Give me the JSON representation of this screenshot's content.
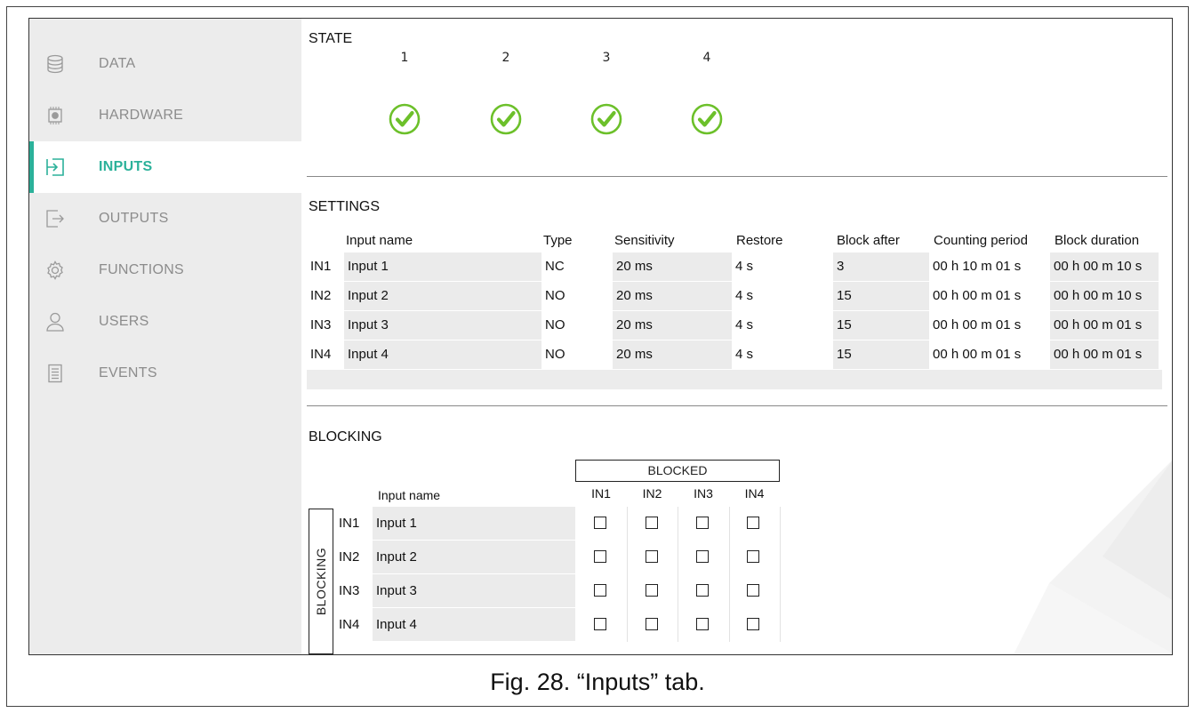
{
  "sidebar": {
    "items": [
      {
        "label": "DATA",
        "icon": "database-icon",
        "active": false
      },
      {
        "label": "HARDWARE",
        "icon": "chip-icon",
        "active": false
      },
      {
        "label": "INPUTS",
        "icon": "input-icon",
        "active": true
      },
      {
        "label": "OUTPUTS",
        "icon": "output-icon",
        "active": false
      },
      {
        "label": "FUNCTIONS",
        "icon": "gear-icon",
        "active": false
      },
      {
        "label": "USERS",
        "icon": "user-icon",
        "active": false
      },
      {
        "label": "EVENTS",
        "icon": "document-icon",
        "active": false
      }
    ]
  },
  "state": {
    "title": "STATE",
    "inputs": [
      {
        "num": "1",
        "status": "ok"
      },
      {
        "num": "2",
        "status": "ok"
      },
      {
        "num": "3",
        "status": "ok"
      },
      {
        "num": "4",
        "status": "ok"
      }
    ]
  },
  "settings": {
    "title": "SETTINGS",
    "columns": [
      "Input name",
      "Type",
      "Sensitivity",
      "Restore",
      "Block after",
      "Counting period",
      "Block duration"
    ],
    "rows": [
      {
        "id": "IN1",
        "name": "Input 1",
        "type": "NC",
        "sensitivity": "20 ms",
        "restore": "4 s",
        "block_after": "3",
        "counting_period": "00 h 10 m 01 s",
        "block_duration": "00 h 00 m 10 s"
      },
      {
        "id": "IN2",
        "name": "Input 2",
        "type": "NO",
        "sensitivity": "20 ms",
        "restore": "4 s",
        "block_after": "15",
        "counting_period": "00 h 00 m 01 s",
        "block_duration": "00 h 00 m 10 s"
      },
      {
        "id": "IN3",
        "name": "Input 3",
        "type": "NO",
        "sensitivity": "20 ms",
        "restore": "4 s",
        "block_after": "15",
        "counting_period": "00 h 00 m 01 s",
        "block_duration": "00 h 00 m 01 s"
      },
      {
        "id": "IN4",
        "name": "Input 4",
        "type": "NO",
        "sensitivity": "20 ms",
        "restore": "4 s",
        "block_after": "15",
        "counting_period": "00 h 00 m 01 s",
        "block_duration": "00 h 00 m 01 s"
      }
    ]
  },
  "blocking": {
    "title": "BLOCKING",
    "blocked_header": "BLOCKED",
    "side_label": "BLOCKING",
    "name_header": "Input name",
    "columns": [
      "IN1",
      "IN2",
      "IN3",
      "IN4"
    ],
    "rows": [
      {
        "id": "IN1",
        "name": "Input 1",
        "checked": [
          false,
          false,
          false,
          false
        ]
      },
      {
        "id": "IN2",
        "name": "Input 2",
        "checked": [
          false,
          false,
          false,
          false
        ]
      },
      {
        "id": "IN3",
        "name": "Input 3",
        "checked": [
          false,
          false,
          false,
          false
        ]
      },
      {
        "id": "IN4",
        "name": "Input 4",
        "checked": [
          false,
          false,
          false,
          false
        ]
      }
    ]
  },
  "caption": "Fig. 28. “Inputs” tab.",
  "colors": {
    "accent": "#2bb19a",
    "ok_green": "#6cc02a",
    "sidebar_bg": "#ececec",
    "row_grey": "#ebebeb"
  }
}
